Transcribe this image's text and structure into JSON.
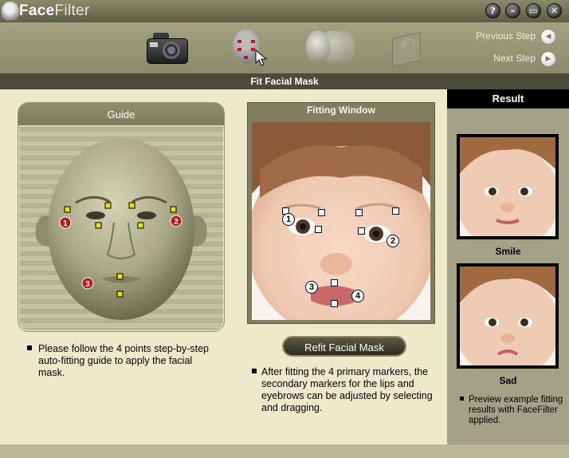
{
  "app": {
    "title_bold": "Face",
    "title_rest": "Filter"
  },
  "window_buttons": [
    {
      "name": "help-button",
      "glyph": "?"
    },
    {
      "name": "minimize-button",
      "glyph": "–"
    },
    {
      "name": "maximize-button",
      "glyph": "▭"
    },
    {
      "name": "close-button",
      "glyph": "✕"
    }
  ],
  "nav": {
    "previous_label": "Previous Step",
    "next_label": "Next Step",
    "previous_glyph": "◀",
    "next_glyph": "▶"
  },
  "section_title": "Fit Facial Mask",
  "guide": {
    "title": "Guide",
    "point_labels": [
      "1",
      "2",
      "3"
    ],
    "note": "Please follow the 4 points step-by-step auto-fitting guide to apply the facial mask."
  },
  "fitting": {
    "title": "Fitting Window",
    "primary_marker_labels": [
      "1",
      "2",
      "3",
      "4"
    ],
    "refit_button": "Refit Facial Mask",
    "note": "After fitting the 4 primary markers, the secondary markers for the lips and eyebrows can be adjusted by selecting and dragging."
  },
  "result": {
    "title": "Result",
    "thumbnails": [
      {
        "label": "Smile"
      },
      {
        "label": "Sad"
      }
    ],
    "note": "Preview example fitting results with FaceFilter applied."
  },
  "colors": {
    "marker_red": "#c0171e",
    "guide_marker_yellow": "#e8e000",
    "section_bar": "#4b4b3a"
  }
}
